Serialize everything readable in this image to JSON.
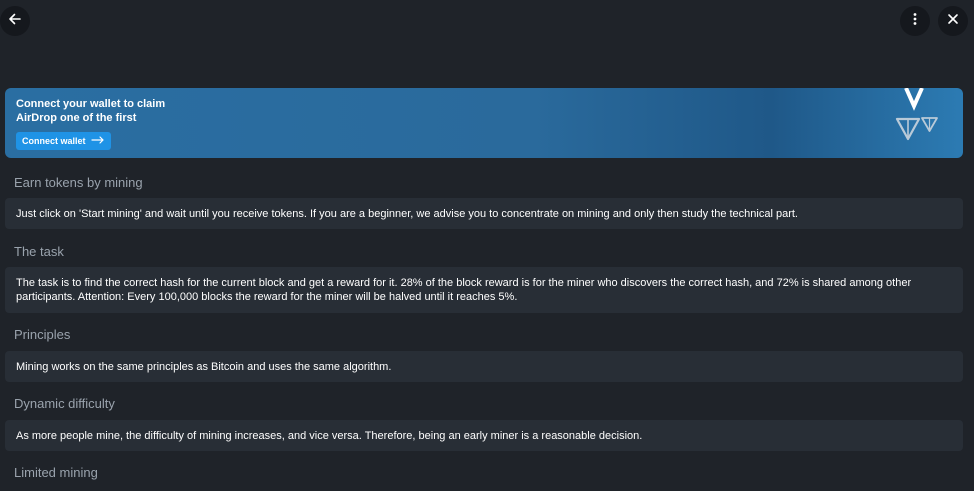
{
  "topbar": {
    "back_icon": "arrow-left-icon",
    "menu_icon": "more-vertical-icon",
    "close_icon": "close-icon"
  },
  "banner": {
    "title_line1": "Connect your wallet to claim",
    "title_line2": "AirDrop one of the first",
    "button_label": "Connect wallet",
    "button_icon": "arrow-right-icon",
    "art_icon": "ton-logo-icon"
  },
  "sections": [
    {
      "title": "Earn tokens by mining",
      "text": "Just click on 'Start mining' and wait until you receive tokens. If you are a beginner, we advise you to concentrate on mining and only then study the technical part."
    },
    {
      "title": "The task",
      "text": "The task is to find the correct hash for the current block and get a reward for it. 28% of the block reward is for the miner who discovers the correct hash, and 72% is shared among other participants. Attention: Every 100,000 blocks the reward for the miner will be halved until it reaches 5%."
    },
    {
      "title": "Principles",
      "text": "Mining works on the same principles as Bitcoin and uses the same algorithm."
    },
    {
      "title": "Dynamic difficulty",
      "text": "As more people mine, the difficulty of mining increases, and vice versa. Therefore, being an early miner is a reasonable decision."
    },
    {
      "title": "Limited mining"
    }
  ],
  "colors": {
    "background": "#1f2329",
    "card": "#282e36",
    "section_title": "#9aa3ad",
    "accent_button": "#1f93e6"
  }
}
